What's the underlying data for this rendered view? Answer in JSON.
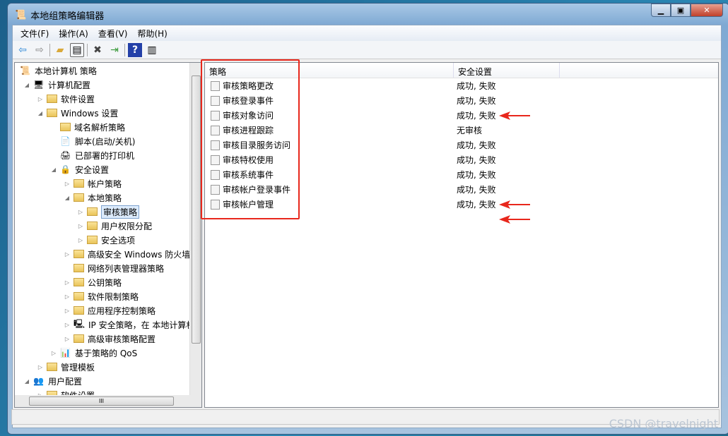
{
  "window": {
    "title": "本地组策略编辑器",
    "controls": {
      "minimize": "▁",
      "maximize": "▣",
      "close": "✕"
    }
  },
  "menu": [
    "文件(F)",
    "操作(A)",
    "查看(V)",
    "帮助(H)"
  ],
  "toolbar": [
    "back-icon",
    "forward-icon",
    "up-folder-icon",
    "show-hide-tree-icon",
    "delete-icon",
    "export-icon",
    "help-icon",
    "action-pane-icon"
  ],
  "tree": [
    {
      "label": "本地计算机 策略",
      "level": 0,
      "arrow": "",
      "icon": "policy"
    },
    {
      "label": "计算机配置",
      "level": 1,
      "arrow": "◢",
      "icon": "computer"
    },
    {
      "label": "软件设置",
      "level": 2,
      "arrow": "▷",
      "icon": "folder"
    },
    {
      "label": "Windows 设置",
      "level": 2,
      "arrow": "◢",
      "icon": "folder"
    },
    {
      "label": "域名解析策略",
      "level": 3,
      "arrow": "",
      "icon": "folder"
    },
    {
      "label": "脚本(启动/关机)",
      "level": 3,
      "arrow": "",
      "icon": "script"
    },
    {
      "label": "已部署的打印机",
      "level": 3,
      "arrow": "",
      "icon": "printer"
    },
    {
      "label": "安全设置",
      "level": 3,
      "arrow": "◢",
      "icon": "security"
    },
    {
      "label": "帐户策略",
      "level": 4,
      "arrow": "▷",
      "icon": "folder"
    },
    {
      "label": "本地策略",
      "level": 4,
      "arrow": "◢",
      "icon": "folder"
    },
    {
      "label": "审核策略",
      "level": 5,
      "arrow": "▷",
      "icon": "folder",
      "selected": true
    },
    {
      "label": "用户权限分配",
      "level": 5,
      "arrow": "▷",
      "icon": "folder"
    },
    {
      "label": "安全选项",
      "level": 5,
      "arrow": "▷",
      "icon": "folder"
    },
    {
      "label": "高级安全 Windows 防火墙",
      "level": 4,
      "arrow": "▷",
      "icon": "folder"
    },
    {
      "label": "网络列表管理器策略",
      "level": 4,
      "arrow": "",
      "icon": "folder"
    },
    {
      "label": "公钥策略",
      "level": 4,
      "arrow": "▷",
      "icon": "folder"
    },
    {
      "label": "软件限制策略",
      "level": 4,
      "arrow": "▷",
      "icon": "folder"
    },
    {
      "label": "应用程序控制策略",
      "level": 4,
      "arrow": "▷",
      "icon": "folder"
    },
    {
      "label": "IP 安全策略，在 本地计算机",
      "level": 4,
      "arrow": "▷",
      "icon": "ipsec"
    },
    {
      "label": "高级审核策略配置",
      "level": 4,
      "arrow": "▷",
      "icon": "folder"
    },
    {
      "label": "基于策略的 QoS",
      "level": 3,
      "arrow": "▷",
      "icon": "chart"
    },
    {
      "label": "管理模板",
      "level": 2,
      "arrow": "▷",
      "icon": "folder"
    },
    {
      "label": "用户配置",
      "level": 1,
      "arrow": "◢",
      "icon": "user"
    },
    {
      "label": "软件设置",
      "level": 2,
      "arrow": "▷",
      "icon": "folder"
    }
  ],
  "list": {
    "columns": [
      "策略",
      "安全设置"
    ],
    "rows": [
      {
        "policy": "审核策略更改",
        "setting": "成功, 失败"
      },
      {
        "policy": "审核登录事件",
        "setting": "成功, 失败",
        "marked": true
      },
      {
        "policy": "审核对象访问",
        "setting": "成功, 失败"
      },
      {
        "policy": "审核进程跟踪",
        "setting": "无审核"
      },
      {
        "policy": "审核目录服务访问",
        "setting": "成功, 失败"
      },
      {
        "policy": "审核特权使用",
        "setting": "成功, 失败"
      },
      {
        "policy": "审核系统事件",
        "setting": "成功, 失败"
      },
      {
        "policy": "审核帐户登录事件",
        "setting": "成功, 失败",
        "marked": true
      },
      {
        "policy": "审核帐户管理",
        "setting": "成功, 失败",
        "marked": true
      }
    ]
  },
  "annotation_color": "#e8271c",
  "watermark": "CSDN @travelnight"
}
